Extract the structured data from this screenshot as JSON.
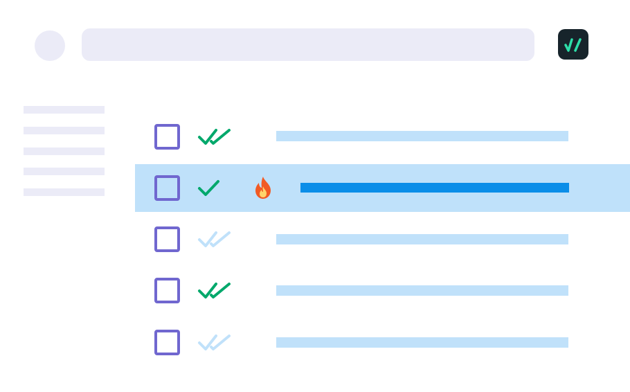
{
  "colors": {
    "placeholder": "#ebebf7",
    "checkbox_border": "#7067cf",
    "read_check": "#00a86b",
    "unread_check": "#c0e1fa",
    "row_bar": "#c0e1fa",
    "selected_row_bg": "#bfe1fa",
    "selected_row_bar": "#0b8ee8",
    "logo_bg": "#17242b",
    "logo_mark": "#2ddfa9",
    "flame": "#f15a24"
  },
  "header": {
    "avatar_icon": "avatar-placeholder",
    "logo_icon": "double-slash-check-logo"
  },
  "sidebar": {
    "items": [
      "",
      "",
      "",
      "",
      ""
    ]
  },
  "list": {
    "rows": [
      {
        "status": "read",
        "icon": "double-check-icon",
        "selected": false,
        "flagged": false
      },
      {
        "status": "sent",
        "icon": "single-check-icon",
        "selected": true,
        "flagged": true,
        "flag_icon": "flame-icon"
      },
      {
        "status": "delivered",
        "icon": "double-check-icon",
        "selected": false,
        "flagged": false
      },
      {
        "status": "read",
        "icon": "double-check-icon",
        "selected": false,
        "flagged": false
      },
      {
        "status": "delivered",
        "icon": "double-check-icon",
        "selected": false,
        "flagged": false
      }
    ]
  }
}
